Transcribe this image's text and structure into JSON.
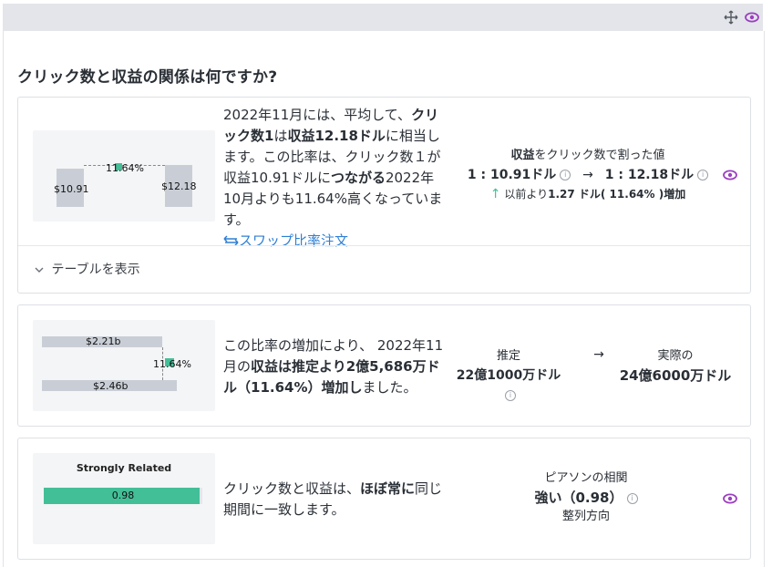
{
  "header": {
    "move_icon": "move-arrows-icon",
    "eye_icon": "eye-icon",
    "accent_color": "#9b3fc0"
  },
  "page": {
    "title": "クリック数と収益の関係は何ですか?"
  },
  "card1": {
    "thumb": {
      "left_value": "$10.91",
      "right_value": "$12.18",
      "change": "11.64%"
    },
    "desc_1": "2022年11月には、平均して、",
    "desc_b1": "クリック数1",
    "desc_2": "は",
    "desc_b2": "収益12.18ドル",
    "desc_3": "に相当します。この比率は、クリック数１が収益10.91ドルに",
    "desc_b3": "つながる",
    "desc_4": "2022年10月よりも11.64%高くなっています。",
    "swap_link": "スワップ比率注文",
    "metric_title_b": "収益",
    "metric_title_rest": "をクリック数で割った値",
    "ratio_from": "1 : 10.91ドル",
    "ratio_to": "1 : 12.18ドル",
    "arrow": "→",
    "change_prefix": "以前より",
    "change_amount": "1.27 ドル( 11.64% )",
    "change_suffix": "増加",
    "show_table": "テーブルを表示"
  },
  "card2": {
    "thumb": {
      "top_value": "$2.21b",
      "bottom_value": "$2.46b",
      "change": "11.64%"
    },
    "desc_1": "この比率の増加により、 2022年11月の",
    "desc_b1": "収益は推定より",
    "desc_2": "2億5,686万ドル",
    "desc_b2": "（11.64%）増加し",
    "desc_3": "ました。",
    "estimated_label": "推定",
    "estimated_value": "22億1000万ドル",
    "actual_label": "実際の",
    "actual_value": "24億6000万ドル",
    "arrow": "→"
  },
  "card3": {
    "thumb": {
      "title": "Strongly Related",
      "value": "0.98",
      "fill_fraction": 0.98,
      "bar_color": "#43bf98"
    },
    "desc_1": "クリック数と収益は、",
    "desc_b1": "ほぼ常に",
    "desc_2": "同じ期間に一致します。",
    "corr_label": "ピアソンの相関",
    "corr_value": "強い（0.98）",
    "direction": "整列方向"
  }
}
